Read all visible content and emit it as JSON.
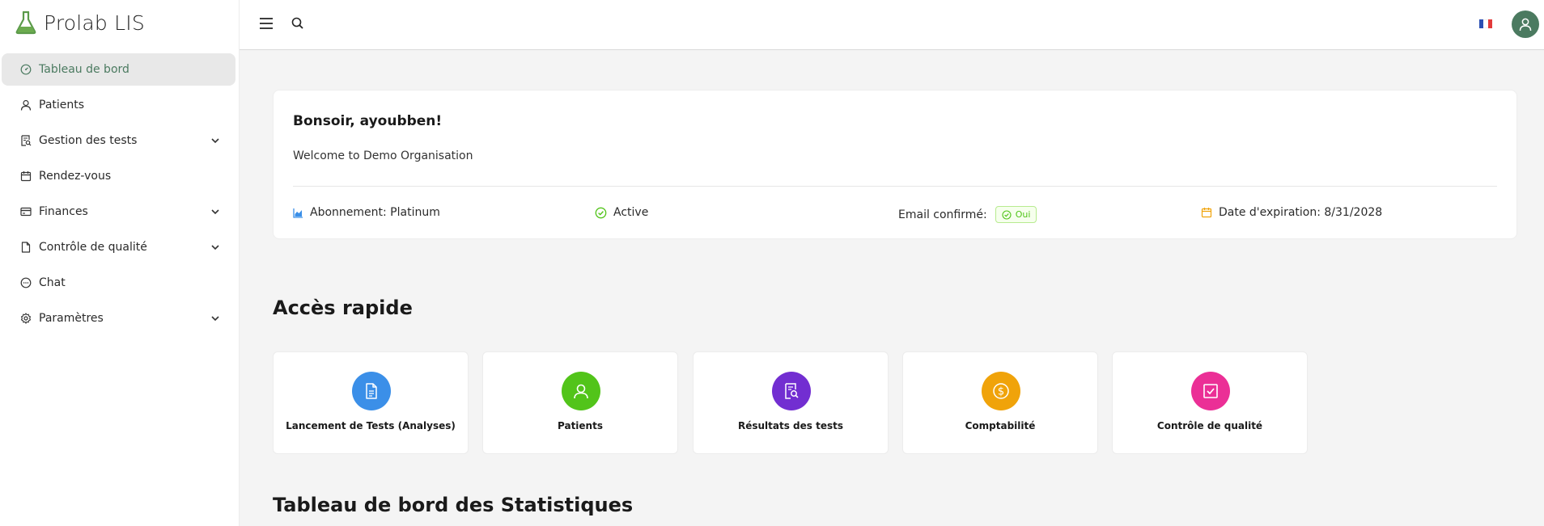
{
  "app": {
    "name": "Prolab LIS"
  },
  "sidebar": {
    "items": [
      {
        "label": "Tableau de bord",
        "icon": "dashboard-icon",
        "active": true,
        "has_submenu": false
      },
      {
        "label": "Patients",
        "icon": "user-icon",
        "active": false,
        "has_submenu": false
      },
      {
        "label": "Gestion des tests",
        "icon": "file-search-icon",
        "active": false,
        "has_submenu": true
      },
      {
        "label": "Rendez-vous",
        "icon": "calendar-icon",
        "active": false,
        "has_submenu": false
      },
      {
        "label": "Finances",
        "icon": "credit-card-icon",
        "active": false,
        "has_submenu": true
      },
      {
        "label": "Contrôle de qualité",
        "icon": "file-icon",
        "active": false,
        "has_submenu": true
      },
      {
        "label": "Chat",
        "icon": "message-icon",
        "active": false,
        "has_submenu": false
      },
      {
        "label": "Paramètres",
        "icon": "gear-icon",
        "active": false,
        "has_submenu": true
      }
    ]
  },
  "header": {
    "language": "fr",
    "colors": {
      "accent": "#4b7a60"
    }
  },
  "welcome": {
    "greeting": "Bonsoir, ayoubben!",
    "message": "Welcome to Demo Organisation",
    "subscription": "Abonnement: Platinum",
    "status": "Active",
    "email_label": "Email confirmé:",
    "email_badge": "Oui",
    "expiration": "Date d'expiration: 8/31/2028"
  },
  "quick_access": {
    "title": "Accès rapide",
    "tiles": [
      {
        "label": "Lancement de Tests (Analyses)",
        "icon": "document-icon",
        "color": "#3b8fe8"
      },
      {
        "label": "Patients",
        "icon": "user-icon",
        "color": "#52c41a"
      },
      {
        "label": "Résultats des tests",
        "icon": "file-search-icon",
        "color": "#722ed1"
      },
      {
        "label": "Comptabilité",
        "icon": "dollar-icon",
        "color": "#f0a30a"
      },
      {
        "label": "Contrôle de qualité",
        "icon": "check-square-icon",
        "color": "#eb2f96"
      }
    ]
  },
  "stats": {
    "title": "Tableau de bord des Statistiques"
  }
}
